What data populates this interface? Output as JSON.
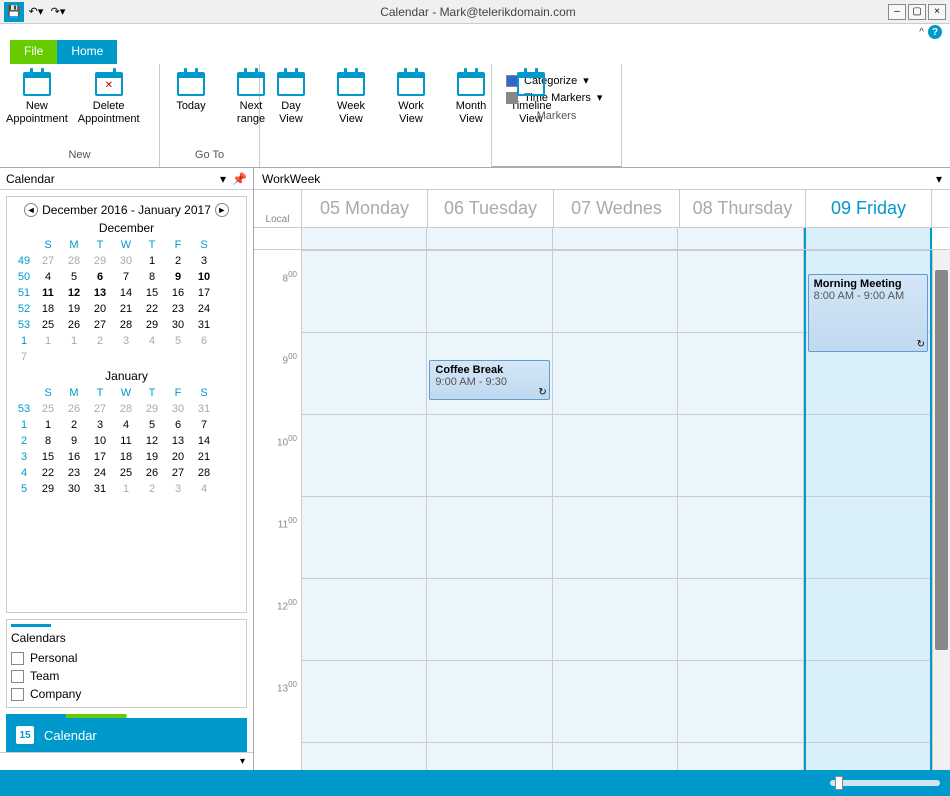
{
  "window": {
    "title": "Calendar - Mark@telerikdomain.com"
  },
  "tabs": {
    "file": "File",
    "home": "Home"
  },
  "ribbon": {
    "new_appt": "New\nAppointment",
    "del_appt": "Delete\nAppointment",
    "group_new": "New",
    "today": "Today",
    "next_range": "Next\nrange",
    "group_goto": "Go To",
    "day_view": "Day\nView",
    "week_view": "Week\nView",
    "work_view": "Work\nView",
    "month_view": "Month\nView",
    "timeline_view": "Timeline\nView",
    "categorize": "Categorize",
    "time_markers": "Time Markers",
    "group_markers": "Markers"
  },
  "sidebar": {
    "title": "Calendar",
    "range": "December 2016 - January 2017",
    "month1": "December",
    "month2": "January",
    "dow": [
      "S",
      "M",
      "T",
      "W",
      "T",
      "F",
      "S"
    ],
    "dec_weeks": [
      "49",
      "50",
      "51",
      "52",
      "53",
      "1"
    ],
    "dec_days": [
      [
        "27",
        "28",
        "29",
        "30",
        "1",
        "2",
        "3"
      ],
      [
        "4",
        "5",
        "6",
        "7",
        "8",
        "9",
        "10"
      ],
      [
        "11",
        "12",
        "13",
        "14",
        "15",
        "16",
        "17"
      ],
      [
        "18",
        "19",
        "20",
        "21",
        "22",
        "23",
        "24"
      ],
      [
        "25",
        "26",
        "27",
        "28",
        "29",
        "30",
        "31"
      ],
      [
        "1",
        "1",
        "2",
        "3",
        "4",
        "5",
        "6",
        "7"
      ]
    ],
    "jan_weeks": [
      "53",
      "1",
      "2",
      "3",
      "4",
      "5"
    ],
    "jan_days": [
      [
        "25",
        "26",
        "27",
        "28",
        "29",
        "30",
        "31"
      ],
      [
        "1",
        "2",
        "3",
        "4",
        "5",
        "6",
        "7"
      ],
      [
        "8",
        "9",
        "10",
        "11",
        "12",
        "13",
        "14"
      ],
      [
        "15",
        "16",
        "17",
        "18",
        "19",
        "20",
        "21"
      ],
      [
        "22",
        "23",
        "24",
        "25",
        "26",
        "27",
        "28"
      ],
      [
        "29",
        "30",
        "31",
        "1",
        "2",
        "3",
        "4"
      ]
    ],
    "calendars_title": "Calendars",
    "calendars": [
      "Personal",
      "Team",
      "Company"
    ],
    "nav_label": "Calendar",
    "nav_icon_text": "15"
  },
  "schedule": {
    "view": "WorkWeek",
    "local": "Local",
    "days": [
      "05 Monday",
      "06 Tuesday",
      "07 Wednes",
      "08 Thursday",
      "09 Friday"
    ],
    "today_index": 4,
    "appts": {
      "coffee": {
        "title": "Coffee Break",
        "time": "9:00 AM  - 9:30"
      },
      "morning": {
        "title": "Morning Meeting",
        "time": "8:00 AM  - 9:00 AM"
      }
    }
  }
}
